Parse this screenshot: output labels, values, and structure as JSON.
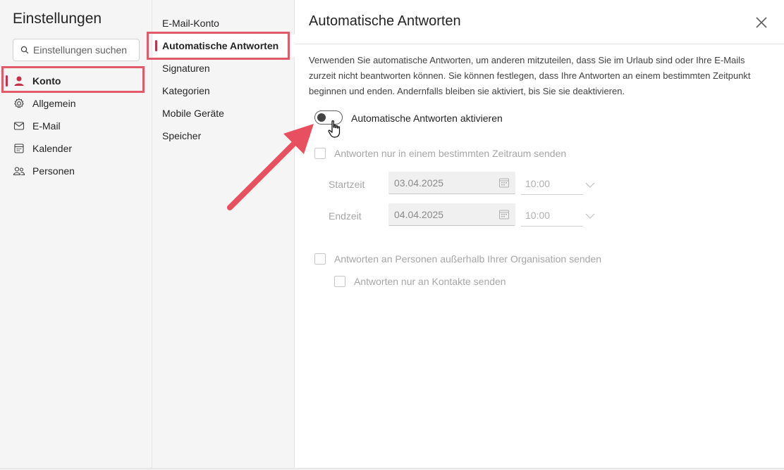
{
  "app": {
    "title": "Einstellungen",
    "search_placeholder": "Einstellungen suchen"
  },
  "sidebar": {
    "items": [
      {
        "label": "Konto",
        "icon": "person-icon",
        "active": true
      },
      {
        "label": "Allgemein",
        "icon": "gear-icon",
        "active": false
      },
      {
        "label": "E-Mail",
        "icon": "mail-icon",
        "active": false
      },
      {
        "label": "Kalender",
        "icon": "calendar-icon",
        "active": false
      },
      {
        "label": "Personen",
        "icon": "people-icon",
        "active": false
      }
    ]
  },
  "subnav": {
    "items": [
      {
        "label": "E-Mail-Konto",
        "active": false
      },
      {
        "label": "Automatische Antworten",
        "active": true
      },
      {
        "label": "Signaturen",
        "active": false
      },
      {
        "label": "Kategorien",
        "active": false
      },
      {
        "label": "Mobile Geräte",
        "active": false
      },
      {
        "label": "Speicher",
        "active": false
      }
    ]
  },
  "panel": {
    "title": "Automatische Antworten",
    "description": "Verwenden Sie automatische Antworten, um anderen mitzuteilen, dass Sie im Urlaub sind oder Ihre E-Mails zurzeit nicht beantworten können. Sie können festlegen, dass Ihre Antworten an einem bestimmten Zeitpunkt beginnen und enden. Andernfalls bleiben sie aktiviert, bis Sie sie deaktivieren.",
    "toggle_label": "Automatische Antworten aktivieren",
    "toggle_on": false,
    "period_checkbox_label": "Antworten nur in einem bestimmten Zeitraum senden",
    "start_label": "Startzeit",
    "start_date": "03.04.2025",
    "start_time": "10:00",
    "end_label": "Endzeit",
    "end_date": "04.04.2025",
    "end_time": "10:00",
    "external_checkbox_label": "Antworten an Personen außerhalb Ihrer Organisation senden",
    "contacts_checkbox_label": "Antworten nur an Kontakte senden"
  },
  "colors": {
    "accent": "#c4314b",
    "highlight": "#e05a6a",
    "arrow": "#e8505f"
  }
}
